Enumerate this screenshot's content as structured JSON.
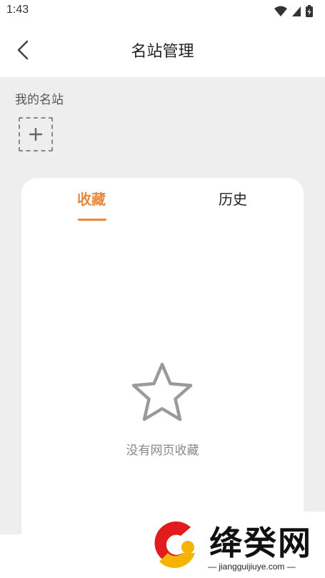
{
  "status_bar": {
    "time": "1:43",
    "icons": [
      "wifi-icon",
      "cellular-signal-icon",
      "battery-icon"
    ]
  },
  "header": {
    "back_icon": "chevron-left-icon",
    "title": "名站管理"
  },
  "my_sites": {
    "label": "我的名站",
    "add_icon": "plus-icon"
  },
  "tabs": [
    {
      "label": "收藏",
      "active": true
    },
    {
      "label": "历史",
      "active": false
    }
  ],
  "empty_state": {
    "icon": "star-outline-icon",
    "message": "没有网页收藏"
  },
  "watermark": {
    "brand": "绛癸网",
    "url": "— jiangguijiuye.com —"
  },
  "colors": {
    "accent": "#e8883e",
    "background": "#eeeeee",
    "card": "#ffffff",
    "empty_text": "#888888"
  }
}
